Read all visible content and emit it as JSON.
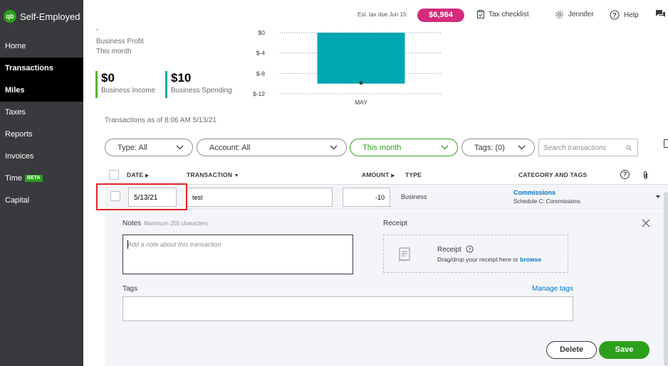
{
  "app": {
    "name": "Self-Employed",
    "logo_text": "qb"
  },
  "sidebar": {
    "items": [
      {
        "label": "Home"
      },
      {
        "label": "Transactions"
      },
      {
        "label": "Miles"
      },
      {
        "label": "Taxes"
      },
      {
        "label": "Reports"
      },
      {
        "label": "Invoices"
      },
      {
        "label": "Time",
        "badge": "BETA"
      },
      {
        "label": "Capital"
      }
    ]
  },
  "topbar": {
    "tax_due_label": "Est. tax due Jun 15:",
    "tax_due_amount": "$6,964",
    "tax_checklist": "Tax checklist",
    "user": "Jennifer",
    "help": "Help"
  },
  "summary": {
    "cut_text": "-",
    "profit_label": "Business Profit",
    "period": "This month",
    "income_value": "$0",
    "income_label": "Business Income",
    "spending_value": "$10",
    "spending_label": "Business Spending",
    "income_color": "#53b700",
    "spending_color": "#00a6b0"
  },
  "chart_data": {
    "type": "bar",
    "categories": [
      "MAY"
    ],
    "values": [
      -10
    ],
    "y_ticks": [
      "$0",
      "$-4",
      "$-8",
      "$-12"
    ],
    "ylim": [
      -12,
      0
    ],
    "bar_color": "#00a6b0",
    "grid": true
  },
  "transactions_as_of": "Transactions as of 8:06 AM 5/13/21",
  "filters": {
    "type": "Type: All",
    "account": "Account: All",
    "period": "This month",
    "tags": "Tags: (0)",
    "search_placeholder": "Search transactions"
  },
  "table": {
    "headers": {
      "date": "DATE",
      "transaction": "TRANSACTION",
      "amount": "AMOUNT",
      "type": "TYPE",
      "category": "CATEGORY AND TAGS"
    },
    "row": {
      "date": "5/13/21",
      "transaction": "test",
      "amount": "-10",
      "type": "Business",
      "category": "Commissions",
      "subcategory": "Schedule C: Commissions"
    }
  },
  "detail": {
    "notes_label": "Notes",
    "notes_hint": "Maximum 255 characters",
    "notes_placeholder": "Add a note about this transaction",
    "receipt_label": "Receipt",
    "receipt_title": "Receipt",
    "receipt_drop_text": "Drag/drop your receipt here or",
    "receipt_browse": "browse",
    "tags_label": "Tags",
    "manage_tags": "Manage tags",
    "delete": "Delete",
    "save": "Save"
  }
}
